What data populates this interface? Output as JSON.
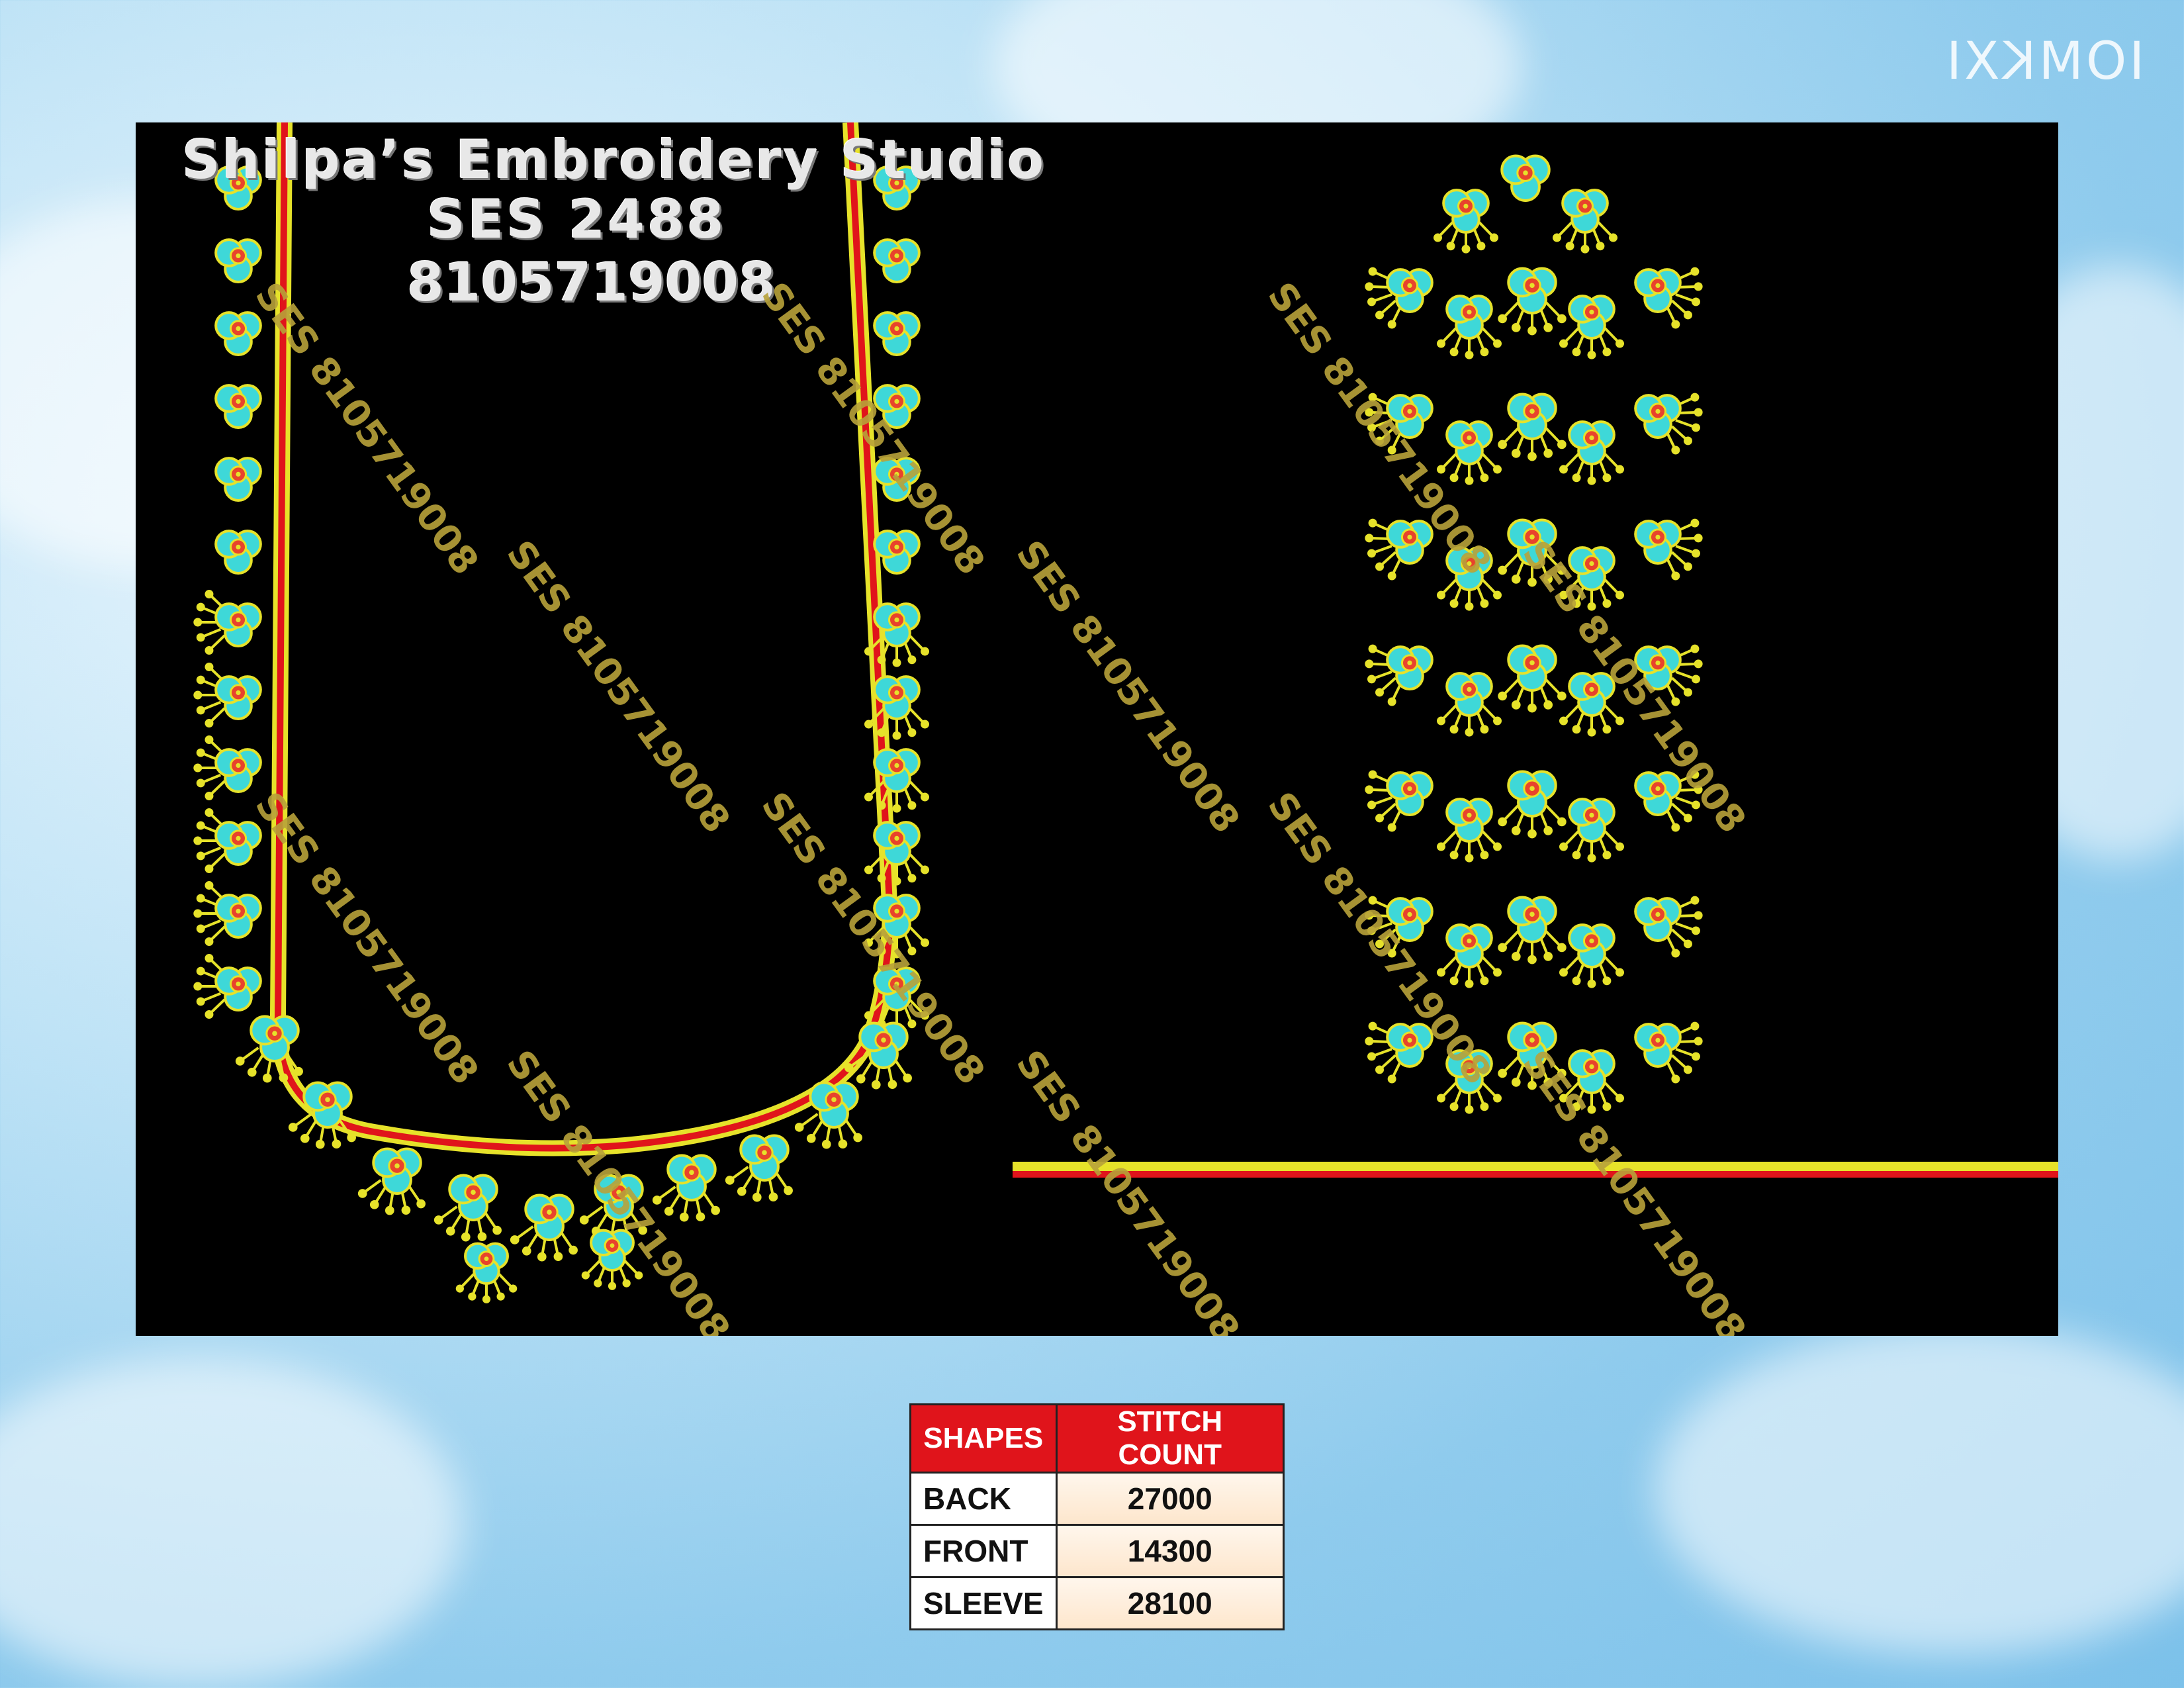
{
  "branding": {
    "studio_name": "Shilpa’s Embroidery Studio",
    "design_code": "SES 2488",
    "phone": "8105719008",
    "watermark": "SES 8105719008",
    "corner_logo": "IOMKXI"
  },
  "stitch_table": {
    "headers": [
      "SHAPES",
      "STITCH COUNT"
    ],
    "rows": [
      {
        "shape": "BACK",
        "count": "27000"
      },
      {
        "shape": "FRONT",
        "count": "14300"
      },
      {
        "shape": "SLEEVE",
        "count": "28100"
      }
    ]
  },
  "colors": {
    "background": "#000000",
    "flower_fill": "#3ed8d8",
    "flower_center": "#e8432c",
    "thread_yellow": "#e6e22a",
    "thread_red": "#e0141b",
    "header_red": "#e0141b"
  }
}
